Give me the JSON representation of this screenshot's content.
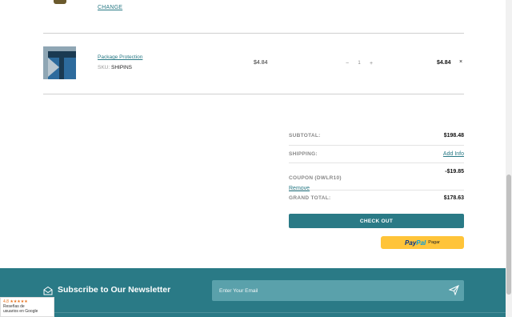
{
  "prev_item": {
    "change_label": "CHANGE"
  },
  "cart_item": {
    "name": "Package Protection",
    "sku_label": "SKU:",
    "sku_value": "SHIPINS",
    "price": "$4.84",
    "qty_minus": "−",
    "quantity": "1",
    "qty_plus": "+",
    "total": "$4.84",
    "remove_symbol": "×"
  },
  "summary": {
    "subtotal_label": "SUBTOTAL:",
    "subtotal_value": "$198.48",
    "shipping_label": "SHIPPING:",
    "shipping_link": "Add Info",
    "coupon_label": "COUPON (DWLR10)",
    "coupon_remove": "Remove",
    "coupon_value": "-$19.85",
    "grand_total_label": "GRAND TOTAL:",
    "grand_total_value": "$178.63"
  },
  "checkout_label": "CHECK OUT",
  "paypal": {
    "logo_pay": "Pay",
    "logo_pal": "Pal",
    "text": "Pagar"
  },
  "newsletter": {
    "title": "Subscribe to Our Newsletter",
    "placeholder": "Enter Your Email"
  },
  "google_badge": {
    "rating": "4.8 ★★★★★",
    "line1": "Reseñas de",
    "line2": "usuarios en Google"
  },
  "colors": {
    "accent": "#2a7a86",
    "paypal_yellow": "#ffc439"
  }
}
